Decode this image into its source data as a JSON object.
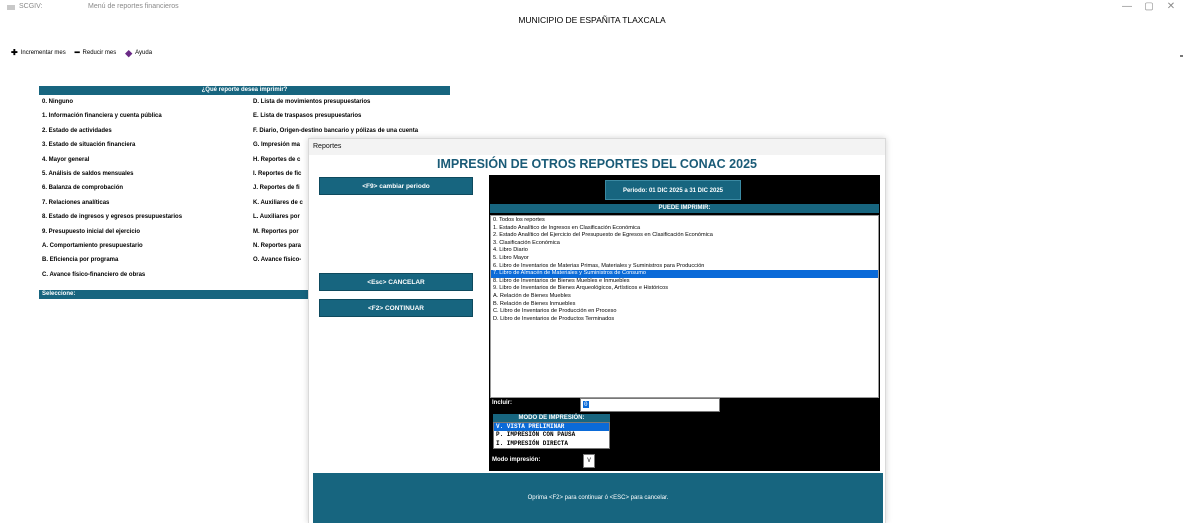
{
  "window": {
    "app_name": "SCGIV:",
    "title": "Menú de reportes financieros",
    "minimize": "—",
    "maximize": "▢",
    "close": "✕"
  },
  "main_title": "MUNICIPIO DE ESPAÑITA TLAXCALA",
  "toolbar": {
    "increment": "Incrementar mes",
    "decrement": "Reducir mes",
    "help": "Ayuda"
  },
  "menu": {
    "header": "¿Qué reporte desea imprimir?",
    "left_items": [
      "0. Ninguno",
      "1. Información financiera y cuenta pública",
      "2. Estado de actividades",
      "3. Estado de situación financiera",
      "4. Mayor general",
      "5. Análisis de saldos mensuales",
      "6. Balanza de comprobación",
      "7. Relaciones analíticas",
      "8. Estado de ingresos y egresos presupuestarios",
      "9. Presupuesto inicial del ejercicio",
      "A. Comportamiento presupuestario",
      "B. Eficiencia por programa",
      "C. Avance físico-financiero de obras"
    ],
    "right_items": [
      "D. Lista de movimientos presupuestarios",
      "E. Lista de traspasos presupuestarios",
      "F. Diario, Origen-destino bancario y pólizas de una cuenta",
      "G. Impresión ma",
      "H. Reportes de c",
      "I. Reportes de fic",
      "J. Reportes de fi",
      "K. Auxiliares de c",
      "L. Auxiliares por",
      "M. Reportes por",
      "N. Reportes para",
      "O. Avance físico-"
    ],
    "footer": "Seleccione:"
  },
  "dialog": {
    "title": "Reportes",
    "heading": "IMPRESIÓN DE OTROS REPORTES DEL CONAC 2025",
    "btn_period": "<F9> cambiar periodo",
    "btn_cancel": "<Esc> CANCELAR",
    "btn_continue": "<F2> CONTINUAR",
    "period": "Periodo: 01 DIC 2025 a 31 DIC 2025",
    "can_print": "PUEDE IMPRIMIR:",
    "reports": [
      "0. Todos los reportes",
      "1. Estado Analítico de Ingresos en Clasificación Económica",
      "2. Estado Analítico del Ejercicio del Presupuesto de Egresos en Clasificación Económica",
      "3. Clasificación Económica",
      "4. Libro Diario",
      "5. Libro Mayor",
      "6. Libro de Inventarios de Materias Primas, Materiales y Suministros para Producción",
      "7. Libro de Almacén de Materiales y Suministros de Consumo",
      "8. Libro de Inventarios de Bienes Muebles e Inmuebles",
      "9. Libro de Inventarios de Bienes Arqueológicos, Artísticos e Históricos",
      "A. Relación de Bienes Muebles",
      "B. Relación de Bienes Inmuebles",
      "C. Libro de Inventarios de Producción en Proceso",
      "D. Libro de Inventarios de Productos Terminados"
    ],
    "selected_report_index": 7,
    "incluir_label": "Incluir:",
    "incluir_value": "0",
    "modo_header": "MODO DE IMPRESIÓN:",
    "modo_options": [
      "V. VISTA PRELIMINAR",
      "P. IMPRESIÓN CON PAUSA",
      "I. IMPRESIÓN DIRECTA"
    ],
    "modo_label": "Modo impresión:",
    "modo_value": "V",
    "status": "Oprima <F2> para continuar ó <ESC> para cancelar."
  },
  "colors": {
    "teal": "#17657f",
    "selection": "#0a6ad8",
    "heading": "#1a5b77"
  }
}
